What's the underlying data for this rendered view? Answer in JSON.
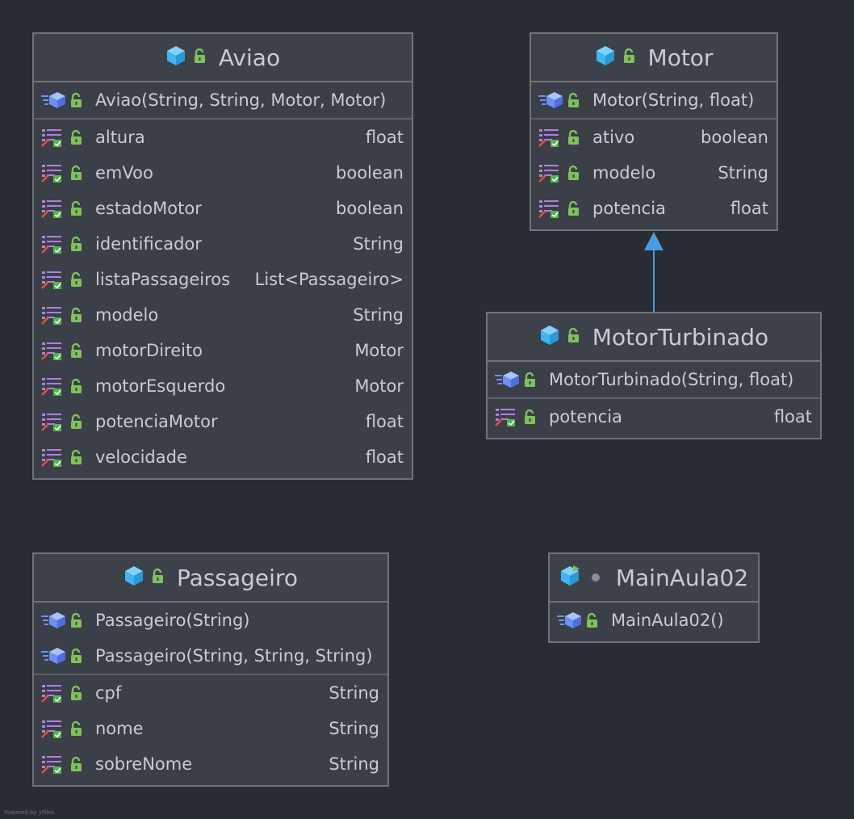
{
  "classes": {
    "aviao": {
      "title": "Aviao",
      "constructors": [
        "Aviao(String, String, Motor, Motor)"
      ],
      "fields": [
        {
          "name": "altura",
          "type": "float"
        },
        {
          "name": "emVoo",
          "type": "boolean"
        },
        {
          "name": "estadoMotor",
          "type": "boolean"
        },
        {
          "name": "identificador",
          "type": "String"
        },
        {
          "name": "listaPassageiros",
          "type": "List<Passageiro>"
        },
        {
          "name": "modelo",
          "type": "String"
        },
        {
          "name": "motorDireito",
          "type": "Motor"
        },
        {
          "name": "motorEsquerdo",
          "type": "Motor"
        },
        {
          "name": "potenciaMotor",
          "type": "float"
        },
        {
          "name": "velocidade",
          "type": "float"
        }
      ]
    },
    "motor": {
      "title": "Motor",
      "constructors": [
        "Motor(String, float)"
      ],
      "fields": [
        {
          "name": "ativo",
          "type": "boolean"
        },
        {
          "name": "modelo",
          "type": "String"
        },
        {
          "name": "potencia",
          "type": "float"
        }
      ]
    },
    "motorTurbinado": {
      "title": "MotorTurbinado",
      "constructors": [
        "MotorTurbinado(String, float)"
      ],
      "fields": [
        {
          "name": "potencia",
          "type": "float"
        }
      ]
    },
    "passageiro": {
      "title": "Passageiro",
      "constructors": [
        "Passageiro(String)",
        "Passageiro(String, String, String)"
      ],
      "fields": [
        {
          "name": "cpf",
          "type": "String"
        },
        {
          "name": "nome",
          "type": "String"
        },
        {
          "name": "sobreNome",
          "type": "String"
        }
      ]
    },
    "mainAula02": {
      "title": "MainAula02",
      "constructors": [
        "MainAula02()"
      ],
      "fields": []
    }
  },
  "footer": "Powered by yFiles",
  "colors": {
    "background": "#282c34",
    "box": "#3a3f48",
    "border": "#707378",
    "class_icon": "#3fb6f2",
    "lock_icon": "#7fc15a",
    "inheritance_arrow": "#4a9be0"
  },
  "icons": {
    "class": "class-cube-icon",
    "lock": "public-lock-icon",
    "constructor": "constructor-icon",
    "field": "field-icon"
  }
}
